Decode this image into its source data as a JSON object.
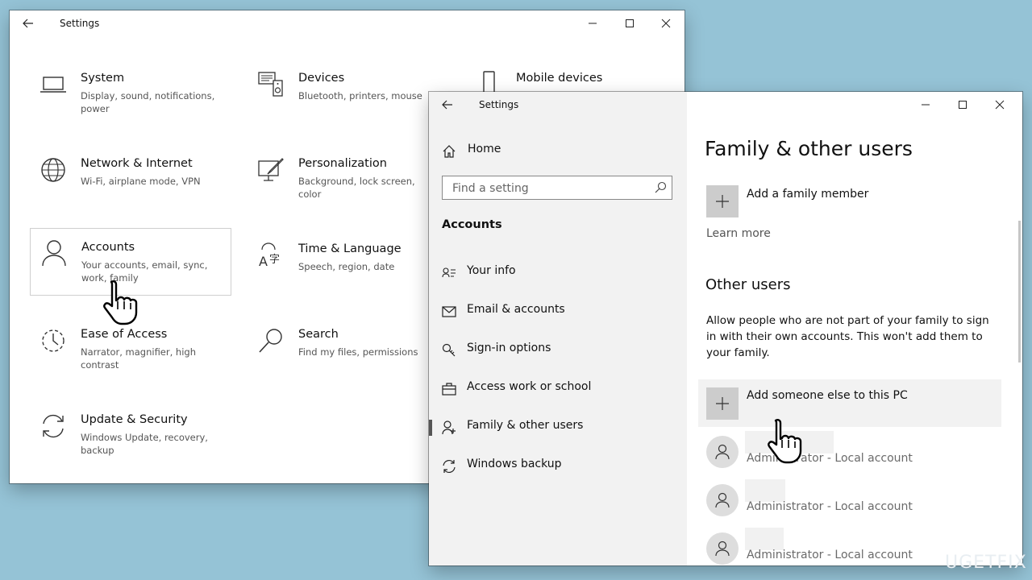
{
  "window_main": {
    "title": "Settings",
    "tiles": [
      {
        "name": "System",
        "desc": "Display, sound, notifications, power",
        "icon": "laptop-icon"
      },
      {
        "name": "Devices",
        "desc": "Bluetooth, printers, mouse",
        "icon": "devices-icon"
      },
      {
        "name": "Mobile devices",
        "desc": "",
        "icon": "phone-icon"
      },
      {
        "name": "Network & Internet",
        "desc": "Wi-Fi, airplane mode, VPN",
        "icon": "globe-icon"
      },
      {
        "name": "Personalization",
        "desc": "Background, lock screen, color",
        "icon": "paint-icon"
      },
      {
        "name": "Accounts",
        "desc": "Your accounts, email, sync, work, family",
        "icon": "person-icon"
      },
      {
        "name": "Time & Language",
        "desc": "Speech, region, date",
        "icon": "time-language-icon"
      },
      {
        "name": "Ease of Access",
        "desc": "Narrator, magnifier, high contrast",
        "icon": "ease-of-access-icon"
      },
      {
        "name": "Search",
        "desc": "Find my files, permissions",
        "icon": "search-icon"
      },
      {
        "name": "Update & Security",
        "desc": "Windows Update, recovery, backup",
        "icon": "sync-icon"
      }
    ]
  },
  "window_accounts": {
    "title": "Settings",
    "nav": {
      "home": "Home",
      "search_placeholder": "Find a setting",
      "section": "Accounts",
      "items": [
        "Your info",
        "Email & accounts",
        "Sign-in options",
        "Access work or school",
        "Family & other users",
        "Windows backup"
      ],
      "selected": "Family & other users"
    },
    "content": {
      "heading": "Family & other users",
      "add_family": "Add a family member",
      "learn_more": "Learn more",
      "other_users_heading": "Other users",
      "other_users_desc": "Allow people who are not part of your family to sign in with their own accounts. This won't add them to your family.",
      "add_someone": "Add someone else to this PC",
      "users": [
        {
          "sub": "Administrator - Local account"
        },
        {
          "sub": "Administrator - Local account"
        },
        {
          "sub": "Administrator - Local account"
        }
      ]
    }
  },
  "watermark": "UGETFIX"
}
